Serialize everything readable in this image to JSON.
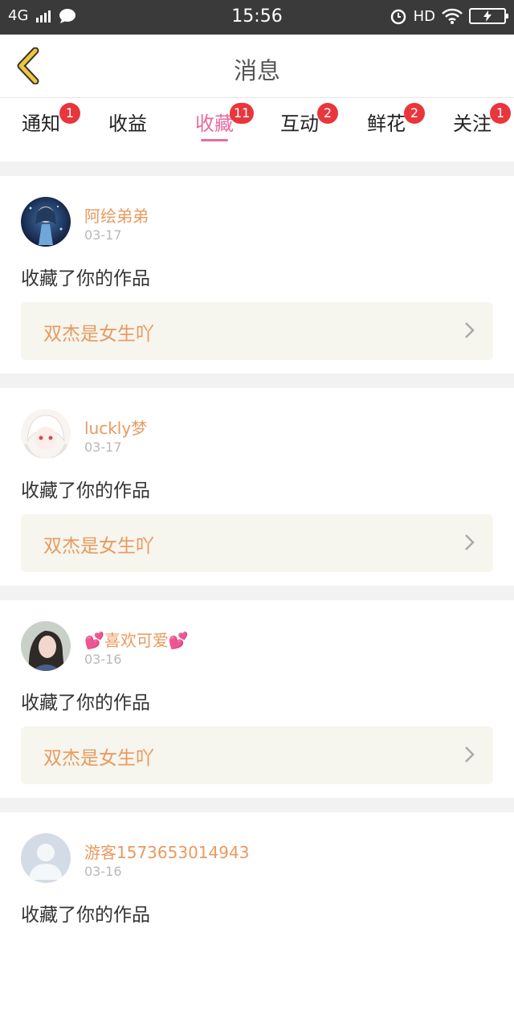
{
  "status_bar": {
    "network": "4G",
    "time": "15:56",
    "hd": "HD",
    "icons": [
      "signal-icon",
      "chat-bubble-icon",
      "alarm-icon",
      "wifi-icon",
      "battery-charging-icon"
    ]
  },
  "header": {
    "title": "消息",
    "back_icon": "chevron-left-icon",
    "accent": "#f0c63c"
  },
  "tabs": [
    {
      "label": "通知",
      "badge": "1",
      "active": false
    },
    {
      "label": "收益",
      "badge": "",
      "active": false
    },
    {
      "label": "收藏",
      "badge": "11",
      "active": true
    },
    {
      "label": "互动",
      "badge": "2",
      "active": false
    },
    {
      "label": "鲜花",
      "badge": "2",
      "active": false
    },
    {
      "label": "关注",
      "badge": "1",
      "active": false
    }
  ],
  "messages": [
    {
      "username": "阿绘弟弟",
      "date": "03-17",
      "action": "收藏了你的作品",
      "work_title": "双杰是女生吖",
      "avatar": "anime-avatar-dark"
    },
    {
      "username": "luckly梦",
      "date": "03-17",
      "action": "收藏了你的作品",
      "work_title": "双杰是女生吖",
      "avatar": "anime-avatar-white"
    },
    {
      "username": "💕喜欢可爱💕",
      "date": "03-16",
      "action": "收藏了你的作品",
      "work_title": "双杰是女生吖",
      "avatar": "photo-avatar"
    },
    {
      "username": "游客1573653014943",
      "date": "03-16",
      "action": "收藏了你的作品",
      "work_title": "",
      "avatar": "default-avatar"
    }
  ],
  "colors": {
    "active_tab": "#e96a9f",
    "badge": "#e8363c",
    "username": "#e89a5e",
    "work_title": "#e89a5e",
    "work_box_bg": "#f6f5ee"
  }
}
